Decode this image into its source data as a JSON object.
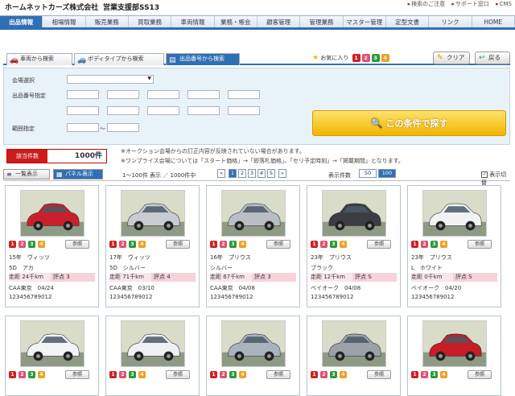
{
  "header": {
    "logo": "ホームネットカーズ株式会社",
    "store": "営業支援部SS13",
    "links": [
      "検索のご注意",
      "サポート窓口",
      "CMS"
    ]
  },
  "nav": [
    {
      "label": "出品情報",
      "active": true
    },
    {
      "label": "相場情報",
      "active": false
    },
    {
      "label": "販売業務",
      "active": false
    },
    {
      "label": "買取業務",
      "active": false
    },
    {
      "label": "車両情報",
      "active": false
    },
    {
      "label": "業務・帳会",
      "active": false
    },
    {
      "label": "顧客管理",
      "active": false
    },
    {
      "label": "管理業務",
      "active": false
    },
    {
      "label": "マスター管理",
      "active": false
    },
    {
      "label": "定型文書",
      "active": false
    },
    {
      "label": "リンク",
      "active": false
    },
    {
      "label": "HOME",
      "active": false
    }
  ],
  "search_tabs": [
    "車両から検索",
    "ボディタイプから検索",
    "出品番号から検索"
  ],
  "favorites": {
    "label": "お気に入り",
    "badges": [
      "1",
      "2",
      "3",
      "4"
    ]
  },
  "buttons": {
    "clear": "クリア",
    "back": "戻る",
    "search": "この条件で探す"
  },
  "form": {
    "venue_label": "会場選択",
    "lot_label": "出品番号指定",
    "range_label": "範囲指定",
    "range_sep": "〜"
  },
  "count": {
    "label": "該当件数",
    "value": "1000件"
  },
  "notes": [
    "※オークション会場からの訂正内容が反映されていない場合があります。",
    "※ワンプライス会場については「スタート価格」→「即落札価格」、「セリ予定時刻」→「掲載期間」となります。"
  ],
  "view": {
    "list": "一覧表示",
    "panel": "パネル表示",
    "range": "1〜100件 表示 ／ 1000件中",
    "pages": [
      "«",
      "1",
      "2",
      "3",
      "4",
      "5",
      "»"
    ],
    "active_page": "1",
    "per_page_label": "表示件数",
    "per_page": [
      "50",
      "100"
    ],
    "active_per_page": "100",
    "toggle": "表示切替",
    "toggle_mark": "✓"
  },
  "card_badges": [
    "1",
    "2",
    "3",
    "4"
  ],
  "detail_label": "参照",
  "cars": [
    {
      "line1": "15年　ヴィッツ",
      "line2": "5D　アカ",
      "mileage": "走距 24千km",
      "score": "評点 3",
      "line4": "CAA東京　04/24",
      "line5": "123456789012",
      "color": "#cc1f2b"
    },
    {
      "line1": "17年　ヴィッツ",
      "line2": "5D　シルバー",
      "mileage": "走距 71千km",
      "score": "評点 4",
      "line4": "CAA東京　03/10",
      "line5": "123456789012",
      "color": "#c8ccd2"
    },
    {
      "line1": "16年　プリウス",
      "line2": "シルバー",
      "mileage": "走距 67千km",
      "score": "評点 3",
      "line4": "CAA東京　04/08",
      "line5": "123456789012",
      "color": "#b9bec6"
    },
    {
      "line1": "23年　プリウス",
      "line2": "ブラック",
      "mileage": "走距 12千km",
      "score": "評点 S",
      "line4": "ベイオーク　04/08",
      "line5": "123456789012",
      "color": "#3a3d42"
    },
    {
      "line1": "23年　プリウス",
      "line2": "L　ホワイト",
      "mileage": "走距 0千km",
      "score": "評点 S",
      "line4": "ベイオーク　04/20",
      "line5": "123456789012",
      "color": "#f0f2f4"
    },
    {
      "color": "#f2f3f4"
    },
    {
      "color": "#eef0f2"
    },
    {
      "color": "#a9b3bd"
    },
    {
      "color": "#9aa2a8"
    },
    {
      "color": "#c81d24"
    }
  ],
  "colors": {
    "accent": "#2f6fb5",
    "red": "#cc1b1b",
    "badge1": "#cc2222",
    "badge2": "#e05070",
    "badge3": "#2a9a3a",
    "badge4": "#f0a020"
  }
}
